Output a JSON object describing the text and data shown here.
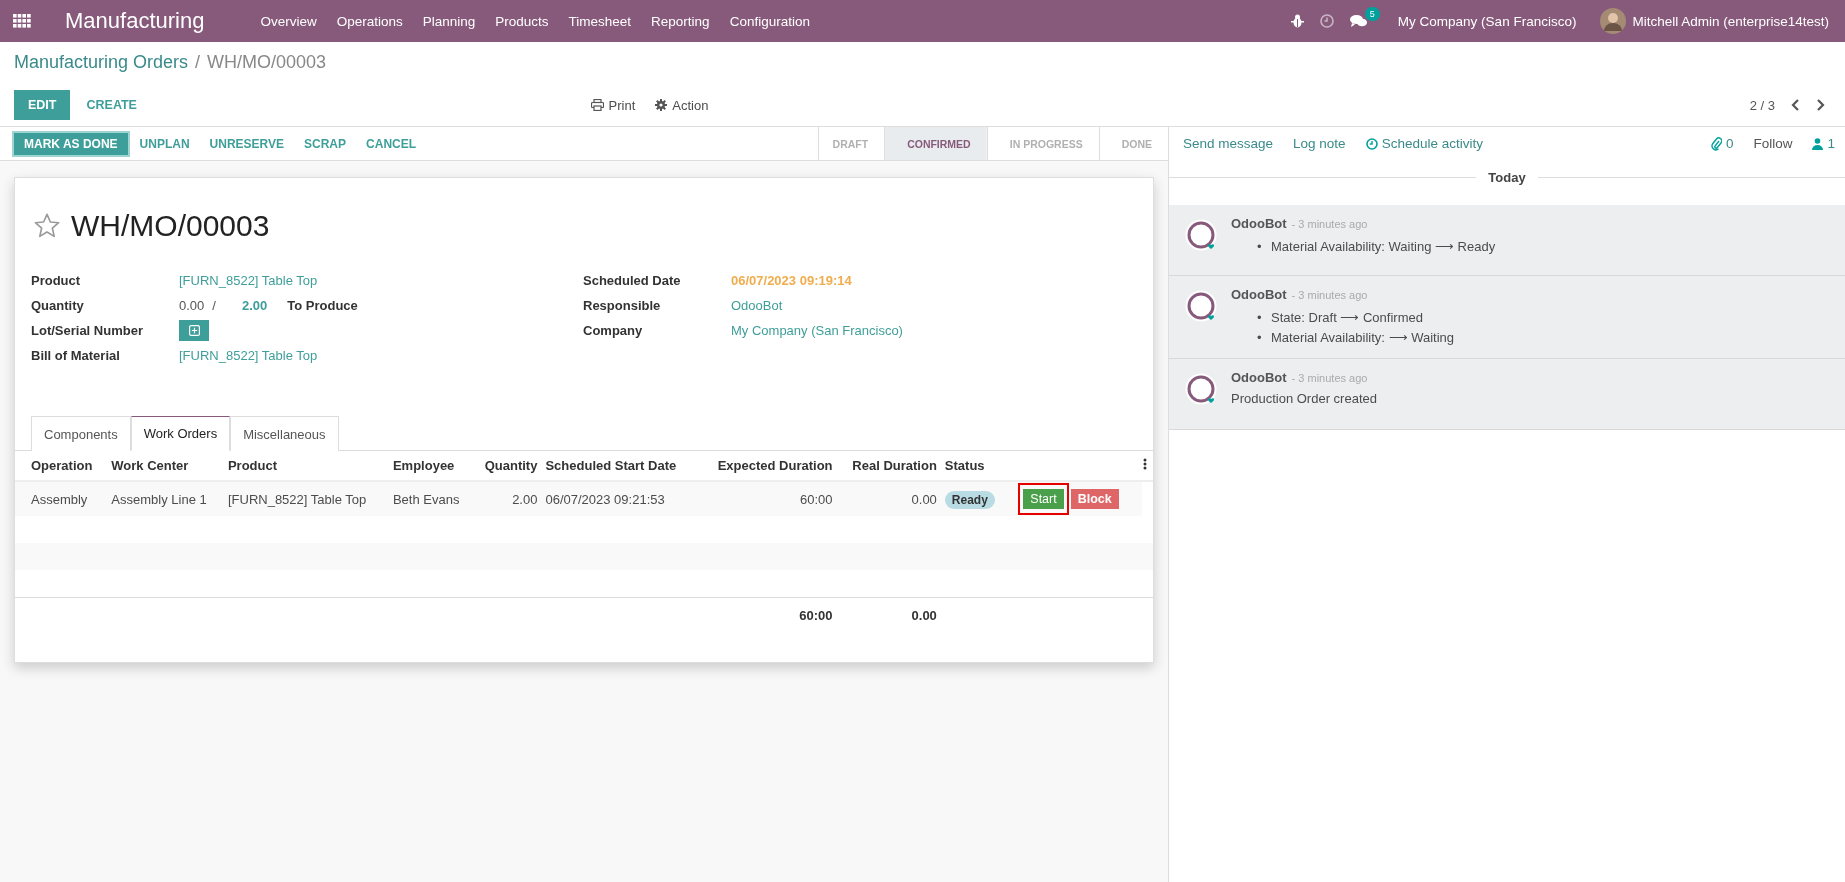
{
  "navbar": {
    "app_name": "Manufacturing",
    "menu": [
      "Overview",
      "Operations",
      "Planning",
      "Products",
      "Timesheet",
      "Reporting",
      "Configuration"
    ],
    "message_count": "5",
    "company": "My Company (San Francisco)",
    "user": "Mitchell Admin (enterprise14test)"
  },
  "breadcrumb": {
    "parent": "Manufacturing Orders",
    "separator": "/",
    "current": "WH/MO/00003"
  },
  "control_buttons": [
    {
      "label": "EDIT",
      "kind": "primary"
    },
    {
      "label": "CREATE",
      "kind": "link"
    }
  ],
  "center_actions": [
    "Print",
    "Action"
  ],
  "pager": {
    "value": "2 / 3"
  },
  "header_buttons": [
    {
      "label": "MARK AS DONE",
      "kind": "primary"
    },
    {
      "label": "UNPLAN",
      "kind": "link"
    },
    {
      "label": "UNRESERVE",
      "kind": "link"
    },
    {
      "label": "SCRAP",
      "kind": "link"
    },
    {
      "label": "CANCEL",
      "kind": "link"
    }
  ],
  "stages": [
    {
      "label": "DRAFT",
      "selected": false
    },
    {
      "label": "CONFIRMED",
      "selected": true
    },
    {
      "label": "IN PROGRESS",
      "selected": false
    },
    {
      "label": "DONE",
      "selected": false
    }
  ],
  "form": {
    "title": "WH/MO/00003",
    "starred": false,
    "left_fields": [
      {
        "label": "Product",
        "kind": "link",
        "value": "[FURN_8522] Table Top"
      },
      {
        "label": "Quantity",
        "kind": "quantity",
        "value": "0.00",
        "separator": "/",
        "target": "2.00",
        "suffix": "To Produce"
      },
      {
        "label": "Lot/Serial Number",
        "kind": "add"
      },
      {
        "label": "Bill of Material",
        "kind": "link",
        "value": "[FURN_8522] Table Top"
      }
    ],
    "right_fields": [
      {
        "label": "Scheduled Date",
        "kind": "warning",
        "value": "06/07/2023 09:19:14"
      },
      {
        "label": "Responsible",
        "kind": "link",
        "value": "OdooBot"
      },
      {
        "label": "Company",
        "kind": "link",
        "value": "My Company (San Francisco)"
      }
    ],
    "tabs": [
      {
        "label": "Components",
        "selected": false
      },
      {
        "label": "Work Orders",
        "selected": true
      },
      {
        "label": "Miscellaneous",
        "selected": false
      }
    ],
    "table": {
      "columns": [
        "Operation",
        "Work Center",
        "Product",
        "Employee",
        "Quantity",
        "Scheduled Start Date",
        "Expected Duration",
        "Real Duration",
        "Status"
      ],
      "rows": [
        {
          "cells": [
            "Assembly",
            "Assembly Line 1",
            "[FURN_8522] Table Top",
            "Beth Evans",
            "2.00",
            "06/07/2023 09:21:53",
            "60:00",
            "0.00"
          ],
          "status": "Ready",
          "actions": [
            {
              "label": "Start",
              "kind": "success",
              "highlighted": true
            },
            {
              "label": "Block",
              "kind": "danger",
              "highlighted": false
            }
          ]
        }
      ],
      "totals": {
        "expected": "60:00",
        "real": "0.00"
      }
    }
  },
  "chatter": {
    "actions": [
      "Send message",
      "Log note",
      "Schedule activity"
    ],
    "attachments": "0",
    "follow": "Follow",
    "followers": "1",
    "date_separator": "Today",
    "messages": [
      {
        "author": "OdooBot",
        "time": "- 3 minutes ago",
        "lines": [
          "Material Availability: Waiting ⟶ Ready"
        ],
        "kind": "tracking",
        "bullet": "•"
      },
      {
        "author": "OdooBot",
        "time": "- 3 minutes ago",
        "lines": [
          "State: Draft ⟶ Confirmed",
          "Material Availability: ⟶ Waiting"
        ],
        "kind": "tracking",
        "bullet": "•"
      },
      {
        "author": "OdooBot",
        "time": "- 3 minutes ago",
        "lines": [
          "Production Order created"
        ],
        "kind": "note"
      }
    ]
  }
}
